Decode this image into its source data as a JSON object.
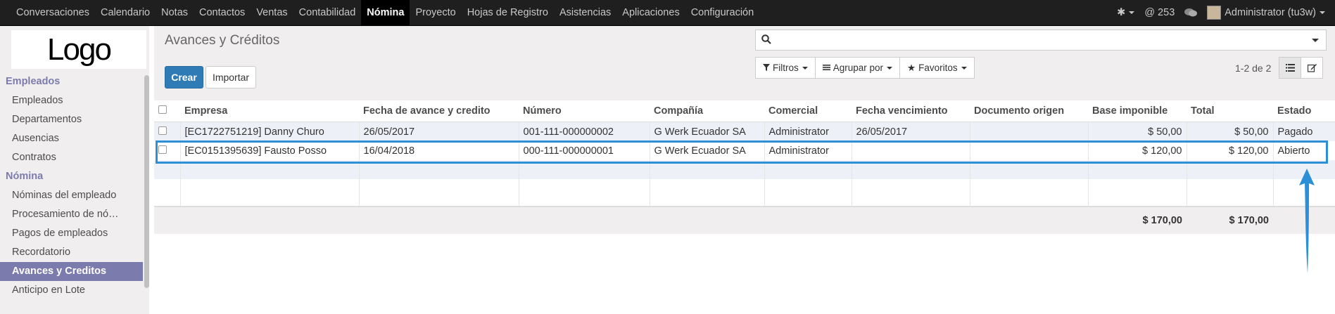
{
  "topbar": {
    "menu": [
      "Conversaciones",
      "Calendario",
      "Notas",
      "Contactos",
      "Ventas",
      "Contabilidad",
      "Nómina",
      "Proyecto",
      "Hojas de Registro",
      "Asistencias",
      "Aplicaciones",
      "Configuración"
    ],
    "active": "Nómina",
    "messages": "@ 253",
    "user": "Administrator (tu3w)"
  },
  "sidebar": {
    "logo": "Logo",
    "sections": [
      {
        "title": "Empleados",
        "items": [
          "Empleados",
          "Departamentos",
          "Ausencias",
          "Contratos"
        ]
      },
      {
        "title": "Nómina",
        "items": [
          "Nóminas del empleado",
          "Procesamiento de nó…",
          "Pagos de empleados",
          "Recordatorio",
          "Avances y Creditos",
          "Anticipo en Lote"
        ]
      }
    ],
    "active_item": "Avances y Creditos"
  },
  "control": {
    "title": "Avances y Créditos",
    "create": "Crear",
    "import": "Importar",
    "filters": "Filtros",
    "group_by": "Agrupar por",
    "favorites": "Favoritos",
    "pager": "1-2 de 2"
  },
  "table": {
    "columns": [
      "Empresa",
      "Fecha de avance y credito",
      "Número",
      "Compañía",
      "Comercial",
      "Fecha vencimiento",
      "Documento origen",
      "Base imponible",
      "Total",
      "Estado"
    ],
    "rows": [
      [
        "[EC1722751219] Danny Churo",
        "26/05/2017",
        "001-111-000000002",
        "G Werk Ecuador SA",
        "Administrator",
        "26/05/2017",
        "",
        "$ 50,00",
        "$ 50,00",
        "Pagado"
      ],
      [
        "[EC0151395639] Fausto Posso",
        "16/04/2018",
        "000-111-000000001",
        "G Werk Ecuador SA",
        "Administrator",
        "",
        "",
        "$ 120,00",
        "$ 120,00",
        "Abierto"
      ]
    ],
    "totals": {
      "base": "$ 170,00",
      "total": "$ 170,00"
    }
  },
  "colors": {
    "accent": "#7c7bad",
    "primary": "#2e7bb6",
    "highlight": "#2d8fd6"
  }
}
